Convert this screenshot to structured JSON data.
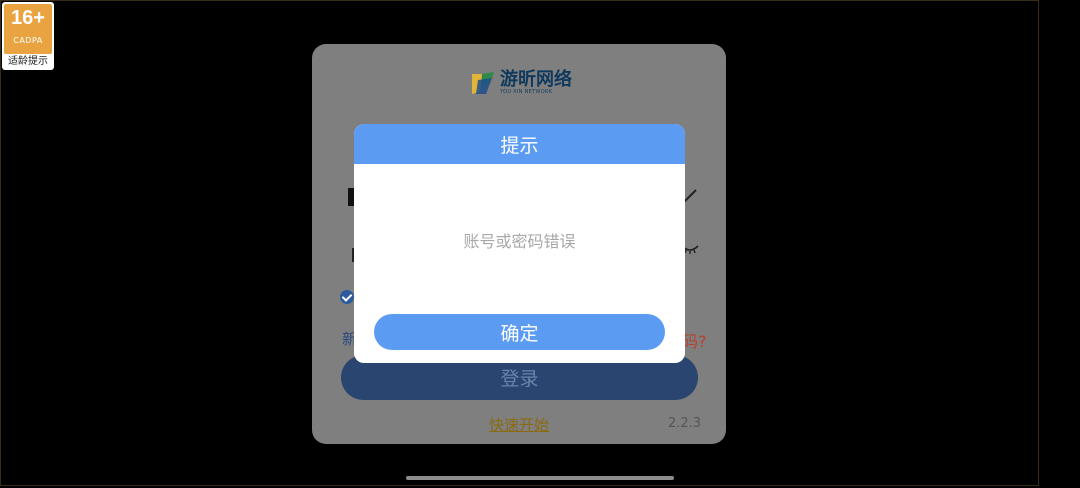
{
  "age_badge": {
    "rating": "16+",
    "org": "CADPA",
    "tip": "适龄提示"
  },
  "logo": {
    "name_cn": "游昕网络",
    "name_en": "YOU XIN NETWORK"
  },
  "login": {
    "new_user_fragment": "新",
    "forgot_fragment": "码?",
    "login_label": "登录",
    "quick_start_label": "快速开始",
    "version": "2.2.3"
  },
  "dialog": {
    "title": "提示",
    "message": "账号或密码错误",
    "confirm_label": "确定"
  },
  "colors": {
    "dialog_accent": "#5b9cf2",
    "login_button": "#2a4570",
    "badge": "#e9a441"
  }
}
